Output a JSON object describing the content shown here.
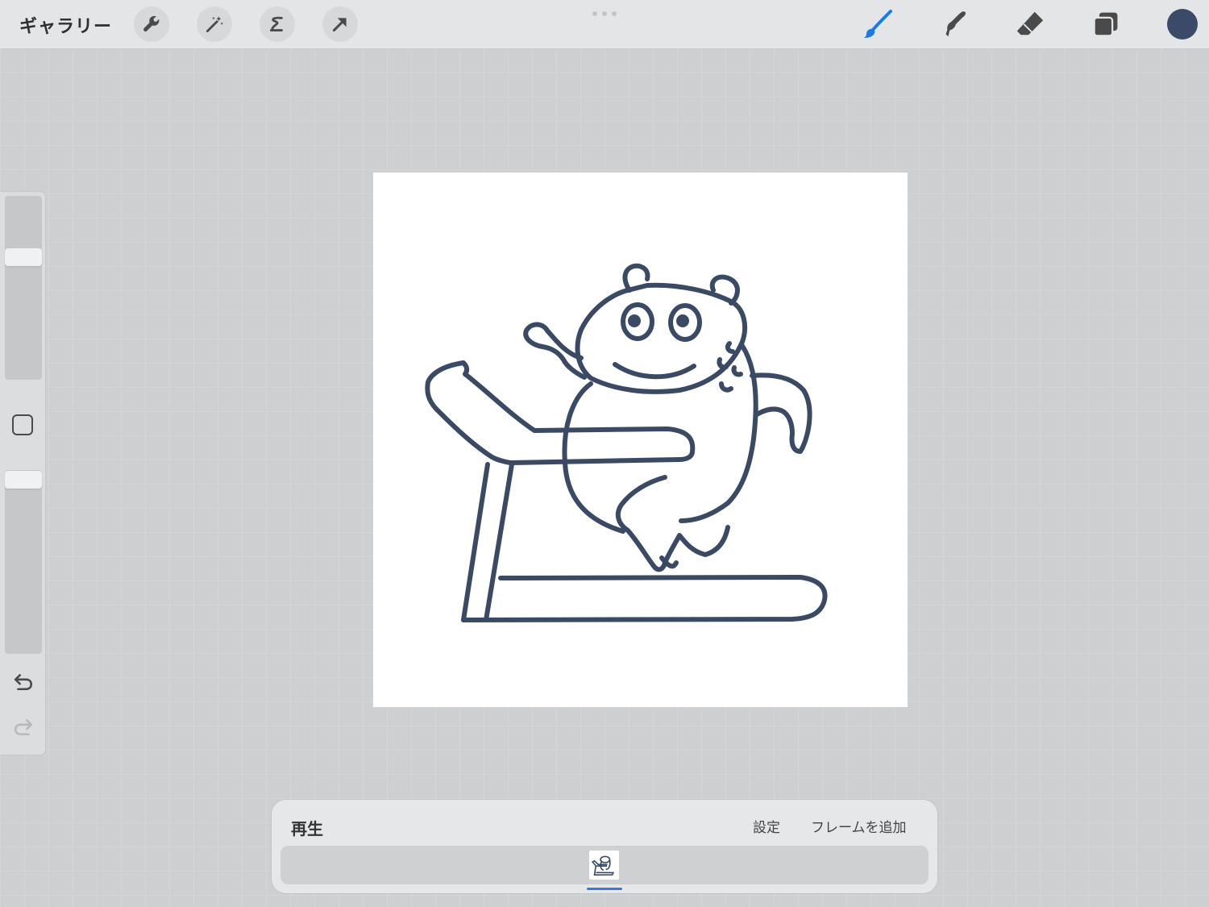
{
  "topbar": {
    "gallery_label": "ギャラリー"
  },
  "colors": {
    "brush_active": "#1a7ae8",
    "current_color": "#3a4a68",
    "stroke": "#3a4a64",
    "frame_indicator": "#2f7de0"
  },
  "tools_left": [
    "wrench-icon",
    "magic-wand-icon",
    "selection-icon",
    "transform-arrow-icon"
  ],
  "tools_right": [
    "brush-icon",
    "smudge-icon",
    "eraser-icon",
    "layers-icon"
  ],
  "animation_panel": {
    "play_label": "再生",
    "settings_label": "設定",
    "add_frame_label": "フレームを追加"
  }
}
